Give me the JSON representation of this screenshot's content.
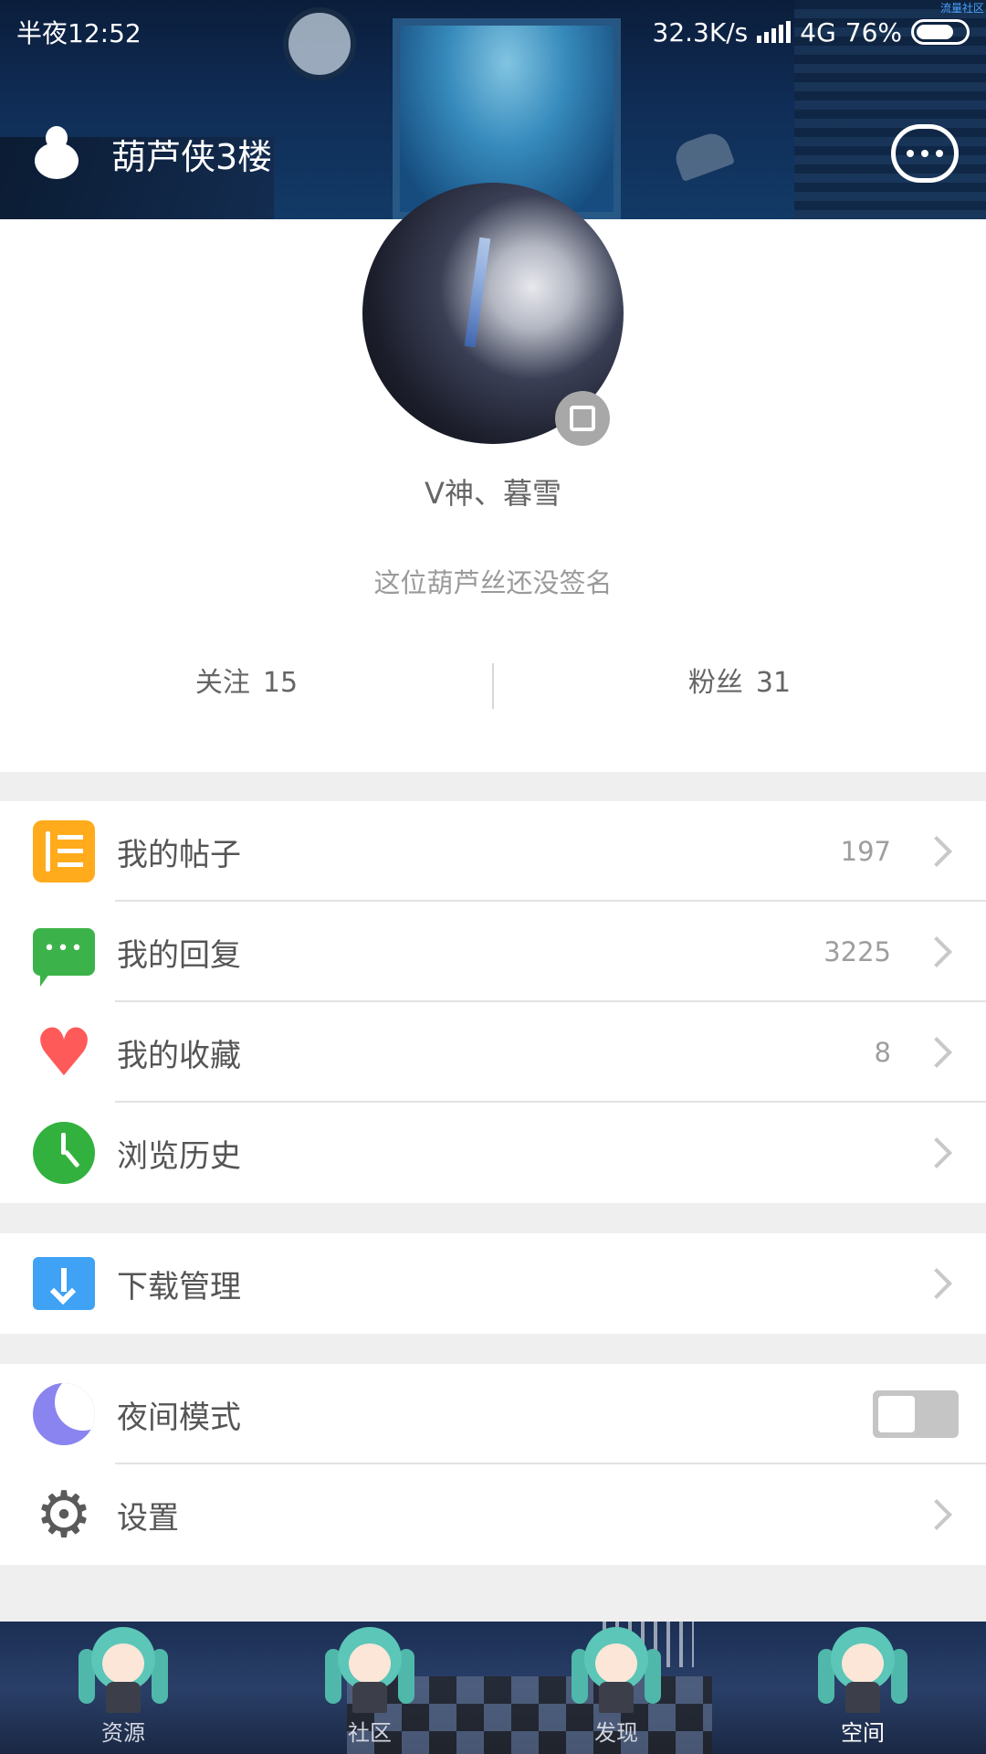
{
  "status_bar": {
    "time": "半夜12:52",
    "network_speed": "32.3K/s",
    "network_type": "4G",
    "battery": "76%",
    "battery_level": 0.76,
    "corner_text": "流量社区"
  },
  "header": {
    "title": "葫芦侠3楼",
    "left_icon": "gourd-icon",
    "right_icon": "chat-bubble-icon"
  },
  "profile": {
    "nickname": "V神、暮雪",
    "signature": "这位葫芦丝还没签名",
    "following_label": "关注",
    "following_count": "15",
    "followers_label": "粉丝",
    "followers_count": "31"
  },
  "menu_group_1": [
    {
      "label": "我的帖子",
      "count": "197",
      "icon": "posts-icon",
      "color": "#ffab1c"
    },
    {
      "label": "我的回复",
      "count": "3225",
      "icon": "reply-icon",
      "color": "#3cb34a"
    },
    {
      "label": "我的收藏",
      "count": "8",
      "icon": "heart-icon",
      "color": "#ff5a5a"
    },
    {
      "label": "浏览历史",
      "count": "",
      "icon": "clock-icon",
      "color": "#33b13f"
    }
  ],
  "menu_group_2": [
    {
      "label": "下载管理",
      "icon": "download-folder-icon",
      "color": "#3fa2f4"
    }
  ],
  "menu_group_3": [
    {
      "label": "夜间模式",
      "icon": "moon-icon",
      "color": "#8a84f0",
      "toggle": false
    },
    {
      "label": "设置",
      "icon": "gear-icon",
      "color": "#5a5a5a"
    }
  ],
  "bottom_nav": [
    {
      "label": "资源",
      "active": false
    },
    {
      "label": "社区",
      "active": false
    },
    {
      "label": "发现",
      "active": false
    },
    {
      "label": "空间",
      "active": true
    }
  ]
}
